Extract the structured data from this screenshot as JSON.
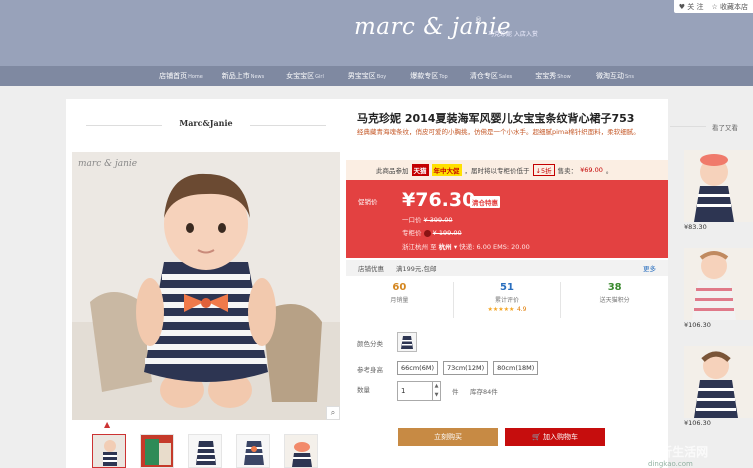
{
  "header": {
    "brand": "marc & janie",
    "brand_mark": "®",
    "tagline": "马克珍妮 入店入赏",
    "top_links": [
      "♥ 关 注",
      "☆ 收藏本店"
    ]
  },
  "nav": [
    {
      "cn": "店铺首页",
      "en": "Home"
    },
    {
      "cn": "新品上市",
      "en": "News"
    },
    {
      "cn": "女宝宝区",
      "en": "Girl"
    },
    {
      "cn": "男宝宝区",
      "en": "Boy"
    },
    {
      "cn": "爆款专区",
      "en": "Top"
    },
    {
      "cn": "清仓专区",
      "en": "Sales"
    },
    {
      "cn": "宝宝秀",
      "en": "Show"
    },
    {
      "cn": "微淘互动",
      "en": "Sns"
    }
  ],
  "store_name": "Marc&Janie",
  "photo_logo": "marc & janie",
  "product": {
    "title": "马克珍妮 2014夏装海军风婴儿女宝宝条纹背心裙子753",
    "subtitle": "经典藏青海魂条纹，俏皮可爱的小胸挑，仿佛是一个小水手。超细腻pima棉针织面料，柔软细腻。",
    "promo": {
      "prefix": "此商品参加",
      "tmall": "天猫",
      "event": "年中大促",
      "middle": "，届时将以专柜价低于",
      "discount": "↓5折",
      "sale_label": "售卖：",
      "sale_price": "¥69.00",
      "suffix": "。"
    },
    "price_label": "促销价",
    "price": "¥76.30",
    "clear_tag": "清仓特惠",
    "one_price_label": "一口价",
    "one_price": "¥ 399.00",
    "counter_label": "专柜价",
    "counter_price": "¥ 199.00",
    "ship_from": "浙江杭州",
    "ship_to_label": "至",
    "ship_to": "杭州 ▾",
    "ship_fee": "快递: 6.00 EMS: 20.00",
    "store_offer_label": "店铺优惠",
    "store_offer": "满199元,包邮",
    "more": "更多",
    "stats": [
      {
        "num": "60",
        "label": "月销量",
        "color": "#d4861f"
      },
      {
        "num": "51",
        "label": "累计评价",
        "color": "#2a6fbf",
        "stars": "★★★★★",
        "rating": "4.9"
      },
      {
        "num": "38",
        "label": "送天猫积分",
        "color": "#3a8a2e"
      }
    ],
    "color_label": "颜色分类",
    "size_label": "参考身高",
    "sizes": [
      "66cm(6M)",
      "73cm(12M)",
      "80cm(18M)"
    ],
    "qty_label": "数量",
    "qty_value": "1",
    "qty_unit": "件",
    "stock": "库存84件",
    "buy_label": "立刻购买",
    "cart_label": "加入购物车"
  },
  "side": {
    "title": "看了又看",
    "items": [
      {
        "price": "¥83.30"
      },
      {
        "price": "¥106.30"
      },
      {
        "price": "¥106.30"
      }
    ]
  },
  "watermark_text": "dingkao.com",
  "colors": {
    "header": "#98a2ba",
    "nav": "#7f89a1",
    "price_box": "#e34141",
    "buy": "#c78a44",
    "cart": "#c60d0d"
  }
}
